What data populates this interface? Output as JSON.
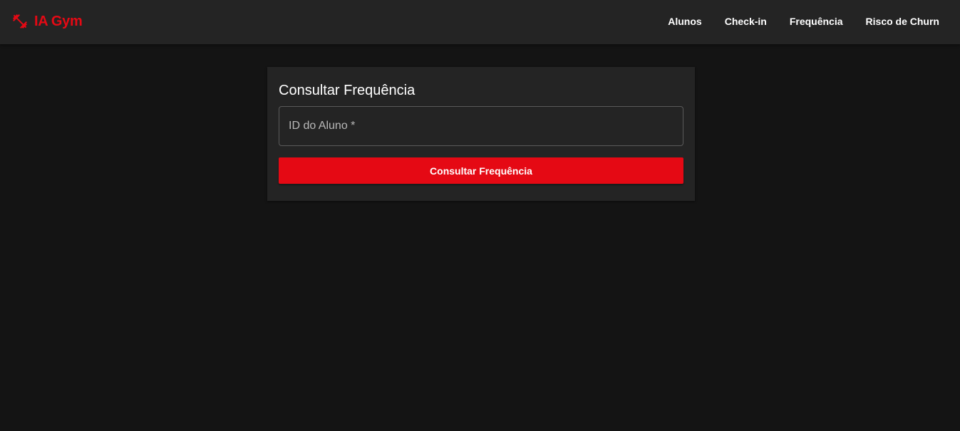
{
  "app": {
    "brand": "IA Gym",
    "brand_icon": "fitness-center-icon",
    "accent_color": "#e50914"
  },
  "nav": {
    "items": [
      {
        "label": "Alunos"
      },
      {
        "label": "Check-in"
      },
      {
        "label": "Frequência"
      },
      {
        "label": "Risco de Churn"
      }
    ]
  },
  "form": {
    "title": "Consultar Frequência",
    "student_id": {
      "placeholder": "ID do Aluno *",
      "value": ""
    },
    "submit_label": "Consultar Frequência"
  }
}
